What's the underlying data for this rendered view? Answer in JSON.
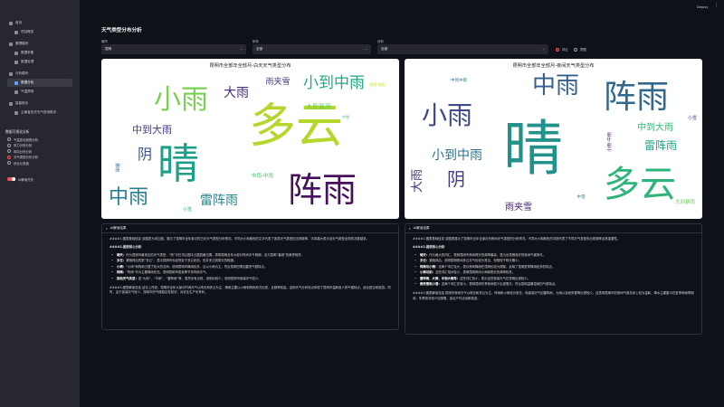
{
  "topbar": {
    "deploy_label": "Deploy",
    "menu_icon": "kebab-icon"
  },
  "sidebar": {
    "nav": [
      {
        "label": "首页",
        "icon": "home-icon",
        "sub": false,
        "active": false
      },
      {
        "label": "项目概览",
        "icon": "overview-icon",
        "sub": true,
        "active": false
      },
      {
        "label": "管理模块",
        "icon": "folder-icon",
        "sub": false,
        "active": false
      },
      {
        "label": "数据采集",
        "icon": "collect-icon",
        "sub": true,
        "active": false
      },
      {
        "label": "数据处理",
        "icon": "process-icon",
        "sub": true,
        "active": false
      },
      {
        "label": "分析模块",
        "icon": "analysis-icon",
        "sub": false,
        "active": false
      },
      {
        "label": "数据分析",
        "icon": "chart-icon",
        "sub": true,
        "active": true
      },
      {
        "label": "气温预测",
        "icon": "forecast-icon",
        "sub": true,
        "active": false
      },
      {
        "label": "智能助手",
        "icon": "assistant-icon",
        "sub": false,
        "active": false
      },
      {
        "label": "云南省历史天气查询助手",
        "icon": "chat-icon",
        "sub": true,
        "active": false
      }
    ],
    "analysis_section_title": "数据可视化分析",
    "analysis_options": [
      {
        "label": "气温变化趋势分析",
        "selected": false
      },
      {
        "label": "风力分布分析",
        "selected": false
      },
      {
        "label": "风向分布分析",
        "selected": false
      },
      {
        "label": "天气类型分布分析",
        "selected": true
      },
      {
        "label": "综合仪表盘",
        "selected": false
      }
    ],
    "ai_toggle_label": "AI解读开关"
  },
  "main": {
    "title": "天气类型分布分析",
    "filters": [
      {
        "label": "城市",
        "value": "昆明"
      },
      {
        "label": "年份",
        "value": "全部"
      },
      {
        "label": "月份",
        "value": "全部"
      }
    ],
    "chart_mode": {
      "options": [
        "词云",
        "饼图"
      ],
      "selected": "词云"
    },
    "clouds": [
      {
        "title": "昆明市全部年全部月-白天天气类型分布",
        "words": [
          {
            "text": "多云",
            "color": "#b5d72b"
          },
          {
            "text": "晴",
            "color": "#1f9e89"
          },
          {
            "text": "阵雨",
            "color": "#46105f"
          },
          {
            "text": "小雨",
            "color": "#7ad151"
          },
          {
            "text": "中雨",
            "color": "#2a7f8e"
          },
          {
            "text": "小到中雨",
            "color": "#22a884"
          },
          {
            "text": "雷阵雨",
            "color": "#25858e"
          },
          {
            "text": "大雨",
            "color": "#472c7a"
          },
          {
            "text": "阴",
            "color": "#3b518b"
          },
          {
            "text": "中到大雨",
            "color": "#433e85"
          },
          {
            "text": "雨夹雪",
            "color": "#443a83"
          },
          {
            "text": "大到暴雨",
            "color": "#65cb5e"
          },
          {
            "text": "中雨-中雨",
            "color": "#42be71"
          },
          {
            "text": "小雪",
            "color": "#35b779"
          },
          {
            "text": "阵雨-阵雨",
            "color": "#c8e020"
          },
          {
            "text": "暴雨",
            "color": "#2c728e"
          },
          {
            "text": "中雪",
            "color": "#5ec962"
          }
        ]
      },
      {
        "title": "昆明市全部年全部月-夜间天气类型分布",
        "words": [
          {
            "text": "晴",
            "color": "#21918c"
          },
          {
            "text": "多云",
            "color": "#2fb47c"
          },
          {
            "text": "阵雨",
            "color": "#31688e"
          },
          {
            "text": "中雨",
            "color": "#355f8d"
          },
          {
            "text": "小雨",
            "color": "#3e4a89"
          },
          {
            "text": "小到中雨",
            "color": "#2c728e"
          },
          {
            "text": "中到大雨",
            "color": "#35b779"
          },
          {
            "text": "雷阵雨",
            "color": "#20a486"
          },
          {
            "text": "阴",
            "color": "#443a83"
          },
          {
            "text": "大雨",
            "color": "#46337e"
          },
          {
            "text": "雨夹雪",
            "color": "#482878"
          },
          {
            "text": "小雪",
            "color": "#3f4788"
          },
          {
            "text": "大到暴雨",
            "color": "#6ece58"
          },
          {
            "text": "中到中雨",
            "color": "#287c8e"
          },
          {
            "text": "小雨-中雨",
            "color": "#482173"
          },
          {
            "text": "中雪",
            "color": "#2a788e"
          }
        ]
      }
    ],
    "expanders": [
      {
        "header": "AI解读结果",
        "intro": "####1.图表基础信息 该图表为词云图，展示了昆明市全年各月的白天天气类型分布情况。不同大小和颜色的文字代表了各类天气类型的出现频率，字体越大表示该天气类型出现的次数越多。",
        "section": "####2.图表核心分析",
        "bullets": [
          {
            "key": "晴天：",
            "text": "作为昆明市最常见的天气类型，“晴”字在词云图中占据显著位置，表明昆明全年大部分时间天气晴朗，这与昆明“春城”的美誉相符。"
          },
          {
            "key": "多云：",
            "text": "紧随其后的是“多云”，显示昆明市也经常处于多云状态。但并未达到阴天的程度。"
          },
          {
            "key": "小雨：",
            "text": "“小雨”和阵雨占据了较大的空间，说明昆明市降雨较多，且以小雨为主，符合昆明四季如春的气候特点。"
          },
          {
            "key": "阵雨：",
            "text": "“阵雨”作为主要降雨形态，表明昆明市夏秋季节多阵雨天气。"
          },
          {
            "key": "其他天气类型：",
            "text": "如“大雨”、“中雨”、“雷阵雨”等，虽然也有出现，但相对较少，说明昆明市极端天气较少。"
          }
        ],
        "summary": "####3.图表解读总结 结论上所述，昆明市全年大部分时间天气以晴天和多云为主，降雨主要以小雨和阵雨形式出现，且频率较高。这种天气分布特点体现了昆明市温和宜人的气候特点，适合居住和旅游。同时，由于极端天气较少，昆明市的气候稳定性较好，对农业生产也有利。"
      },
      {
        "header": "AI解读结果",
        "intro": "####1.图表基础信息 该图表展示了昆明市全年全部月份夜间天气类型的分布情况。不同大小和颜色的词语代表了不同天气类型的出现频率及其重要性。",
        "section": "####2.图表核心分析",
        "bullets": [
          {
            "key": "晴天：",
            "text": "作为最大的词汇，表明昆明市夜间晴天的频率最高，显示出昆明良好的夜间气候条件。"
          },
          {
            "key": "多云：",
            "text": "紧随其后，说明昆明夜间多云天气也较为常见，但相较于晴天略少。"
          },
          {
            "key": "阵雨与小雨：",
            "text": "这两个词汇较大，表示夜间降雨在昆明也较为频繁，反映了昆明夏季降雨较多的特点。"
          },
          {
            "key": "小雨与阴：",
            "text": "这些词汇相对较小，表明昆明夜间小雨和阴天的频率较低。"
          },
          {
            "key": "雷阵雨、大雨、中到大雨等：",
            "text": "这些词汇较小，表示这些极端天气在昆明出现较少。"
          },
          {
            "key": "雨夹雪和小雪：",
            "text": "这两个词汇非常小，表明昆明冬季夜间很少出现雪天，符合昆明温暖湿润的气候特点。"
          }
        ],
        "summary": "####3.图表解读总结 昆明市夜间天气以晴天和多云为主，阵雨和小雨较为常见，而极端天气如雷阵雨、大雨以及雨夹雪等出现较少。这表明昆明市的夜间气候总体上较为温和，降水主要集中在夏季和雨季期间，冬季则非常少见降雪，适合户外活动和旅游。"
      }
    ]
  }
}
